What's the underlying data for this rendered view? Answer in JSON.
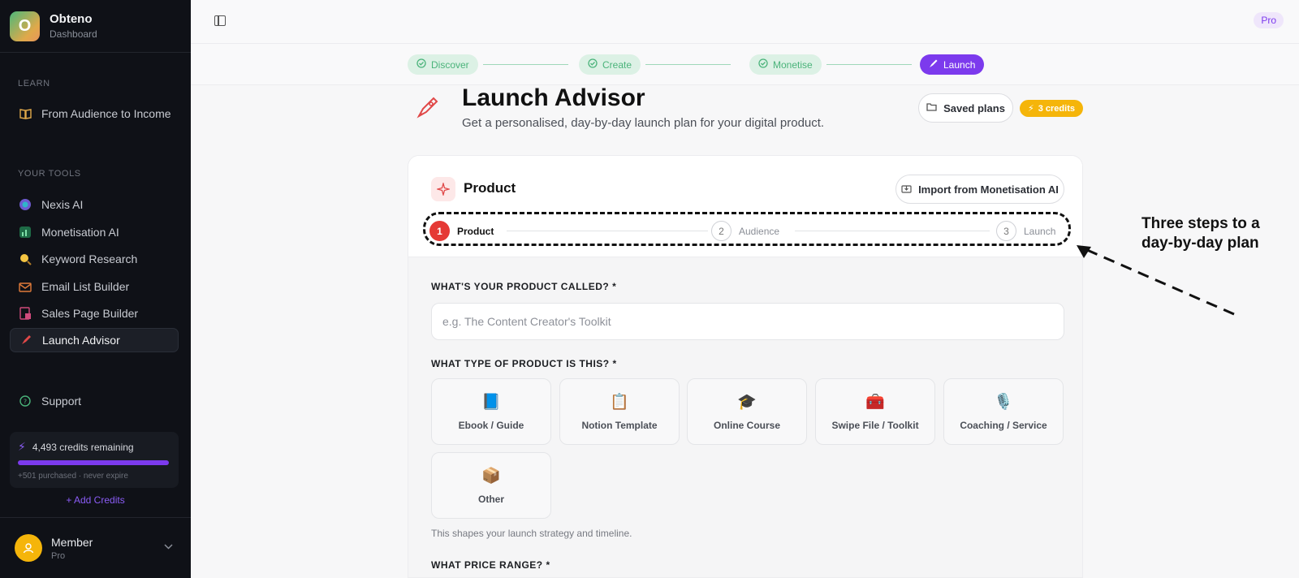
{
  "sidebar": {
    "brand": {
      "logo_letter": "O",
      "name": "Obteno",
      "subtitle": "Dashboard"
    },
    "learn_label": "LEARN",
    "learn_items": [
      {
        "label": "From Audience to Income",
        "icon": "book-icon"
      }
    ],
    "tools_label": "YOUR TOOLS",
    "tools": [
      {
        "label": "Nexis AI",
        "icon": "brain-icon"
      },
      {
        "label": "Monetisation AI",
        "icon": "chart-icon"
      },
      {
        "label": "Keyword Research",
        "icon": "magnifier-icon"
      },
      {
        "label": "Email List Builder",
        "icon": "mail-icon"
      },
      {
        "label": "Sales Page Builder",
        "icon": "page-icon"
      },
      {
        "label": "Launch Advisor",
        "icon": "rocket-icon",
        "active": true
      }
    ],
    "support_label": "Support",
    "credits": {
      "remaining": "4,493 credits remaining",
      "sub": "+501 purchased · never expire",
      "add_label": "+ Add Credits"
    },
    "member": {
      "name": "Member",
      "plan": "Pro"
    }
  },
  "topbar": {
    "badge": "Pro"
  },
  "stepper": [
    {
      "label": "Discover",
      "state": "done"
    },
    {
      "label": "Create",
      "state": "done"
    },
    {
      "label": "Monetise",
      "state": "done"
    },
    {
      "label": "Launch",
      "state": "current"
    }
  ],
  "header": {
    "title": "Launch Advisor",
    "subtitle": "Get a personalised, day-by-day launch plan for your digital product.",
    "saved_plans": "Saved plans",
    "credits_badge": "3 credits"
  },
  "card": {
    "title": "Product",
    "import_label": "Import from Monetisation AI",
    "substeps": [
      {
        "num": "1",
        "label": "Product"
      },
      {
        "num": "2",
        "label": "Audience"
      },
      {
        "num": "3",
        "label": "Launch"
      }
    ],
    "q1_label": "WHAT'S YOUR PRODUCT CALLED? *",
    "q1_placeholder": "e.g. The Content Creator's Toolkit",
    "q2_label": "WHAT TYPE OF PRODUCT IS THIS? *",
    "product_types": [
      {
        "label": "Ebook / Guide",
        "emoji": "📘"
      },
      {
        "label": "Notion Template",
        "emoji": "📋"
      },
      {
        "label": "Online Course",
        "emoji": "🎓"
      },
      {
        "label": "Swipe File / Toolkit",
        "emoji": "🧰"
      },
      {
        "label": "Coaching / Service",
        "emoji": "🎙️"
      },
      {
        "label": "Other",
        "emoji": "📦"
      }
    ],
    "hint": "This shapes your launch strategy and timeline.",
    "q3_label": "WHAT PRICE RANGE? *"
  },
  "annotation": {
    "line1": "Three steps to a",
    "line2": "day-by-day plan"
  }
}
